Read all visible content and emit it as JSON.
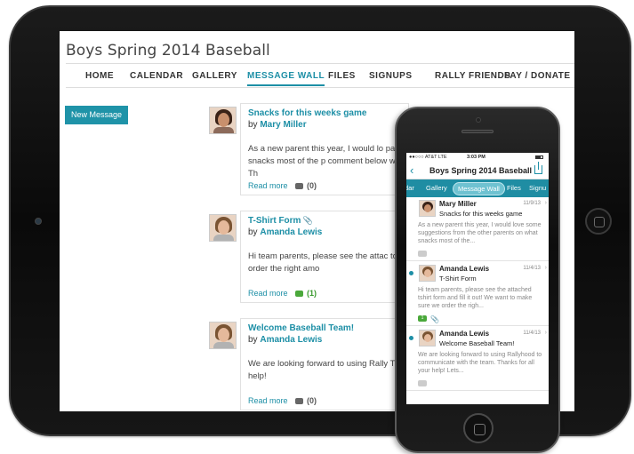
{
  "tablet": {
    "site_title": "Boys Spring 2014 Baseball",
    "nav": [
      "HOME",
      "CALENDAR",
      "GALLERY",
      "MESSAGE WALL",
      "FILES",
      "SIGNUPS",
      "RALLY FRIENDS",
      "PAY / DONATE"
    ],
    "active_nav": "MESSAGE WALL",
    "new_message_label": "New Message",
    "posts": [
      {
        "title": "Snacks for this weeks game",
        "by": "by",
        "author": "Mary Miller",
        "body": "As a new parent this year, I would lo parents on what snacks most of the p comment below with your advice! Th",
        "read_more": "Read more",
        "comments": "(0)"
      },
      {
        "title": "T-Shirt Form",
        "by": "by",
        "author": "Amanda Lewis",
        "body": "Hi team parents, please see the attac to make sure we order the right amo",
        "read_more": "Read more",
        "comments": "(1)"
      },
      {
        "title": "Welcome Baseball Team!",
        "by": "by",
        "author": "Amanda Lewis",
        "body": "We are looking forward to using Rally Thanks for all your help!",
        "read_more": "Read more",
        "comments": "(0)"
      }
    ]
  },
  "phone": {
    "carrier": "●●○○○ AT&T  LTE",
    "time": "3:03 PM",
    "title": "Boys Spring 2014 Baseball",
    "back_icon": "‹",
    "tabs": [
      "dar",
      "Gallery",
      "Message Wall",
      "Files",
      "Signu"
    ],
    "active_tab": "Message Wall",
    "messages": [
      {
        "name": "Mary  Miller",
        "date": "11/9/13",
        "subject": "Snacks for this weeks game",
        "preview": "As a new parent this year, I would love some suggestions from the other parents on what snacks most of the...",
        "unread": false
      },
      {
        "name": "Amanda Lewis",
        "date": "11/4/13",
        "subject": "T-Shirt Form",
        "preview": "Hi team parents, please see the attached tshirt form and fill it out! We want to make sure we order the righ...",
        "comment_count": "1",
        "unread": true
      },
      {
        "name": "Amanda Lewis",
        "date": "11/4/13",
        "subject": "Welcome Baseball Team!",
        "preview": "We are looking forward to using Rallyhood to communicate with the team. Thanks for all your help!  Lets...",
        "unread": true
      }
    ]
  },
  "colors": {
    "accent": "#1d8fa6",
    "tab_bar": "#1f8da3",
    "green": "#4aa83a"
  }
}
